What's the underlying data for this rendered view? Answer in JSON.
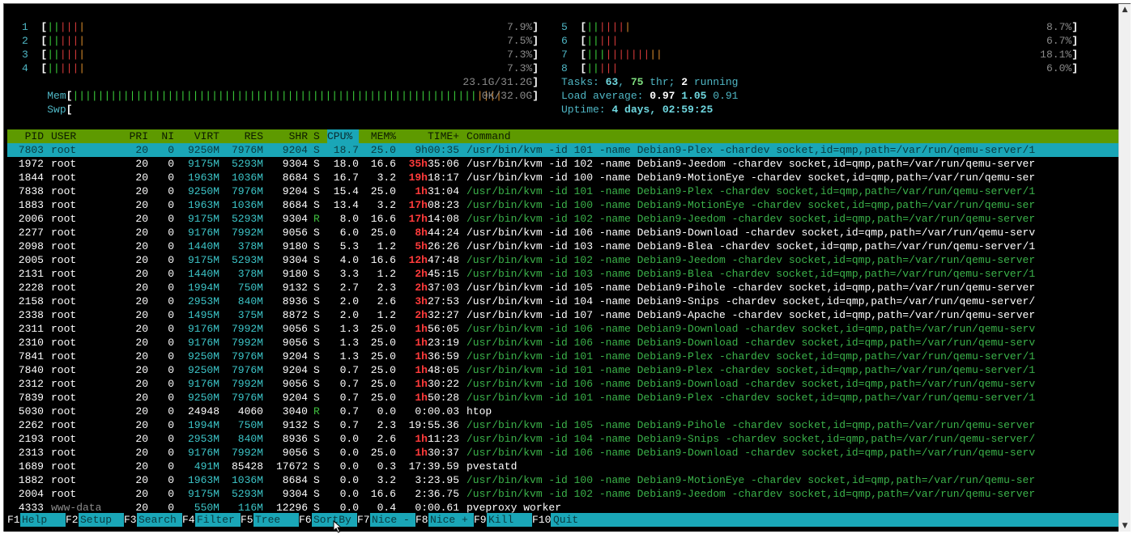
{
  "cpus": [
    {
      "id": "1",
      "bars": [
        {
          "c": "g",
          "t": "||"
        },
        {
          "c": "r",
          "t": "|||"
        },
        {
          "c": "o",
          "t": "|"
        }
      ],
      "pct": "7.9%"
    },
    {
      "id": "2",
      "bars": [
        {
          "c": "g",
          "t": "||"
        },
        {
          "c": "r",
          "t": "|||"
        },
        {
          "c": "o",
          "t": "|"
        }
      ],
      "pct": "7.5%"
    },
    {
      "id": "3",
      "bars": [
        {
          "c": "g",
          "t": "||"
        },
        {
          "c": "r",
          "t": "|||"
        },
        {
          "c": "o",
          "t": "|"
        }
      ],
      "pct": "7.3%"
    },
    {
      "id": "4",
      "bars": [
        {
          "c": "g",
          "t": "||"
        },
        {
          "c": "r",
          "t": "|||"
        },
        {
          "c": "o",
          "t": "|"
        }
      ],
      "pct": "7.3%"
    },
    {
      "id": "5",
      "bars": [
        {
          "c": "g",
          "t": "||"
        },
        {
          "c": "r",
          "t": "||||"
        },
        {
          "c": "o",
          "t": "|"
        }
      ],
      "pct": "8.7%"
    },
    {
      "id": "6",
      "bars": [
        {
          "c": "g",
          "t": "||"
        },
        {
          "c": "r",
          "t": "|||"
        }
      ],
      "pct": "6.7%"
    },
    {
      "id": "7",
      "bars": [
        {
          "c": "g",
          "t": "|||"
        },
        {
          "c": "r",
          "t": "|||||||"
        },
        {
          "c": "o",
          "t": "||"
        }
      ],
      "pct": "18.1%"
    },
    {
      "id": "8",
      "bars": [
        {
          "c": "g",
          "t": "||"
        },
        {
          "c": "r",
          "t": "|||"
        }
      ],
      "pct": "6.0%"
    }
  ],
  "mem": {
    "label": "Mem",
    "bars": "||||||||||||||||||||||||||||||||||||||||||||||||||||||||||||||||",
    "tail": "||||",
    "value": "23.1G/31.2G"
  },
  "swp": {
    "label": "Swp",
    "value": "0K/32.0G"
  },
  "tasks": {
    "label": "Tasks: ",
    "count": "63",
    "sep": ", ",
    "threads": "75",
    "thr": " thr; ",
    "running": "2",
    "running_label": " running"
  },
  "load": {
    "label": "Load average: ",
    "l1": "0.97",
    "l5": "1.05",
    "l15": "0.91"
  },
  "uptime": {
    "label": "Uptime: ",
    "value": "4 days, 02:59:25"
  },
  "columns": [
    "PID",
    "USER",
    "PRI",
    "NI",
    "VIRT",
    "RES",
    "SHR",
    "S",
    "CPU%",
    "MEM%",
    "TIME+",
    "Command"
  ],
  "processes": [
    {
      "pid": "7803",
      "user": "root",
      "pri": "20",
      "ni": "0",
      "virt": "9250M",
      "res": "7976M",
      "shr": "9204",
      "s": "S",
      "cpu": "18.7",
      "mem": "25.0",
      "timeh": "9h",
      "timem": "00:35",
      "cmd": "/usr/bin/kvm -id 101 -name Debian9-Plex -chardev socket,id=qmp,path=/var/run/qemu-server/1",
      "thread": false,
      "sel": true
    },
    {
      "pid": "1972",
      "user": "root",
      "pri": "20",
      "ni": "0",
      "virt": "9175M",
      "res": "5293M",
      "shr": "9304",
      "s": "S",
      "cpu": "18.0",
      "mem": "16.6",
      "timeh": "35h",
      "timem": "35:06",
      "cmd": "/usr/bin/kvm -id 102 -name Debian9-Jeedom -chardev socket,id=qmp,path=/var/run/qemu-server",
      "thread": false
    },
    {
      "pid": "1844",
      "user": "root",
      "pri": "20",
      "ni": "0",
      "virt": "1963M",
      "res": "1036M",
      "shr": "8684",
      "s": "S",
      "cpu": "16.7",
      "mem": "3.2",
      "timeh": "19h",
      "timem": "18:17",
      "cmd": "/usr/bin/kvm -id 100 -name Debian9-MotionEye -chardev socket,id=qmp,path=/var/run/qemu-ser",
      "thread": false
    },
    {
      "pid": "7838",
      "user": "root",
      "pri": "20",
      "ni": "0",
      "virt": "9250M",
      "res": "7976M",
      "shr": "9204",
      "s": "S",
      "cpu": "15.4",
      "mem": "25.0",
      "timeh": "1h",
      "timem": "31:04",
      "cmd": "/usr/bin/kvm -id 101 -name Debian9-Plex -chardev socket,id=qmp,path=/var/run/qemu-server/1",
      "thread": true
    },
    {
      "pid": "1883",
      "user": "root",
      "pri": "20",
      "ni": "0",
      "virt": "1963M",
      "res": "1036M",
      "shr": "8684",
      "s": "S",
      "cpu": "13.4",
      "mem": "3.2",
      "timeh": "17h",
      "timem": "08:23",
      "cmd": "/usr/bin/kvm -id 100 -name Debian9-MotionEye -chardev socket,id=qmp,path=/var/run/qemu-ser",
      "thread": true
    },
    {
      "pid": "2006",
      "user": "root",
      "pri": "20",
      "ni": "0",
      "virt": "9175M",
      "res": "5293M",
      "shr": "9304",
      "s": "R",
      "cpu": "8.0",
      "mem": "16.6",
      "timeh": "17h",
      "timem": "14:08",
      "cmd": "/usr/bin/kvm -id 102 -name Debian9-Jeedom -chardev socket,id=qmp,path=/var/run/qemu-server",
      "thread": true
    },
    {
      "pid": "2277",
      "user": "root",
      "pri": "20",
      "ni": "0",
      "virt": "9176M",
      "res": "7992M",
      "shr": "9056",
      "s": "S",
      "cpu": "6.0",
      "mem": "25.0",
      "timeh": "8h",
      "timem": "44:24",
      "cmd": "/usr/bin/kvm -id 106 -name Debian9-Download -chardev socket,id=qmp,path=/var/run/qemu-serv",
      "thread": false
    },
    {
      "pid": "2098",
      "user": "root",
      "pri": "20",
      "ni": "0",
      "virt": "1440M",
      "res": "378M",
      "shr": "9180",
      "s": "S",
      "cpu": "5.3",
      "mem": "1.2",
      "timeh": "5h",
      "timem": "26:26",
      "cmd": "/usr/bin/kvm -id 103 -name Debian9-Blea -chardev socket,id=qmp,path=/var/run/qemu-server/1",
      "thread": false
    },
    {
      "pid": "2005",
      "user": "root",
      "pri": "20",
      "ni": "0",
      "virt": "9175M",
      "res": "5293M",
      "shr": "9304",
      "s": "S",
      "cpu": "4.0",
      "mem": "16.6",
      "timeh": "12h",
      "timem": "47:48",
      "cmd": "/usr/bin/kvm -id 102 -name Debian9-Jeedom -chardev socket,id=qmp,path=/var/run/qemu-server",
      "thread": true
    },
    {
      "pid": "2131",
      "user": "root",
      "pri": "20",
      "ni": "0",
      "virt": "1440M",
      "res": "378M",
      "shr": "9180",
      "s": "S",
      "cpu": "3.3",
      "mem": "1.2",
      "timeh": "2h",
      "timem": "45:15",
      "cmd": "/usr/bin/kvm -id 103 -name Debian9-Blea -chardev socket,id=qmp,path=/var/run/qemu-server/1",
      "thread": true
    },
    {
      "pid": "2228",
      "user": "root",
      "pri": "20",
      "ni": "0",
      "virt": "1994M",
      "res": "750M",
      "shr": "9132",
      "s": "S",
      "cpu": "2.7",
      "mem": "2.3",
      "timeh": "2h",
      "timem": "37:03",
      "cmd": "/usr/bin/kvm -id 105 -name Debian9-Pihole -chardev socket,id=qmp,path=/var/run/qemu-server",
      "thread": false
    },
    {
      "pid": "2158",
      "user": "root",
      "pri": "20",
      "ni": "0",
      "virt": "2953M",
      "res": "840M",
      "shr": "8936",
      "s": "S",
      "cpu": "2.0",
      "mem": "2.6",
      "timeh": "3h",
      "timem": "27:53",
      "cmd": "/usr/bin/kvm -id 104 -name Debian9-Snips -chardev socket,id=qmp,path=/var/run/qemu-server/",
      "thread": false
    },
    {
      "pid": "2338",
      "user": "root",
      "pri": "20",
      "ni": "0",
      "virt": "1495M",
      "res": "375M",
      "shr": "8872",
      "s": "S",
      "cpu": "2.0",
      "mem": "1.2",
      "timeh": "2h",
      "timem": "32:27",
      "cmd": "/usr/bin/kvm -id 107 -name Debian9-Apache -chardev socket,id=qmp,path=/var/run/qemu-server",
      "thread": false
    },
    {
      "pid": "2311",
      "user": "root",
      "pri": "20",
      "ni": "0",
      "virt": "9176M",
      "res": "7992M",
      "shr": "9056",
      "s": "S",
      "cpu": "1.3",
      "mem": "25.0",
      "timeh": "1h",
      "timem": "56:05",
      "cmd": "/usr/bin/kvm -id 106 -name Debian9-Download -chardev socket,id=qmp,path=/var/run/qemu-serv",
      "thread": true
    },
    {
      "pid": "2310",
      "user": "root",
      "pri": "20",
      "ni": "0",
      "virt": "9176M",
      "res": "7992M",
      "shr": "9056",
      "s": "S",
      "cpu": "1.3",
      "mem": "25.0",
      "timeh": "1h",
      "timem": "23:19",
      "cmd": "/usr/bin/kvm -id 106 -name Debian9-Download -chardev socket,id=qmp,path=/var/run/qemu-serv",
      "thread": true
    },
    {
      "pid": "7841",
      "user": "root",
      "pri": "20",
      "ni": "0",
      "virt": "9250M",
      "res": "7976M",
      "shr": "9204",
      "s": "S",
      "cpu": "1.3",
      "mem": "25.0",
      "timeh": "1h",
      "timem": "36:59",
      "cmd": "/usr/bin/kvm -id 101 -name Debian9-Plex -chardev socket,id=qmp,path=/var/run/qemu-server/1",
      "thread": true
    },
    {
      "pid": "7840",
      "user": "root",
      "pri": "20",
      "ni": "0",
      "virt": "9250M",
      "res": "7976M",
      "shr": "9204",
      "s": "S",
      "cpu": "0.7",
      "mem": "25.0",
      "timeh": "1h",
      "timem": "48:05",
      "cmd": "/usr/bin/kvm -id 101 -name Debian9-Plex -chardev socket,id=qmp,path=/var/run/qemu-server/1",
      "thread": true
    },
    {
      "pid": "2312",
      "user": "root",
      "pri": "20",
      "ni": "0",
      "virt": "9176M",
      "res": "7992M",
      "shr": "9056",
      "s": "S",
      "cpu": "0.7",
      "mem": "25.0",
      "timeh": "1h",
      "timem": "30:22",
      "cmd": "/usr/bin/kvm -id 106 -name Debian9-Download -chardev socket,id=qmp,path=/var/run/qemu-serv",
      "thread": true
    },
    {
      "pid": "7839",
      "user": "root",
      "pri": "20",
      "ni": "0",
      "virt": "9250M",
      "res": "7976M",
      "shr": "9204",
      "s": "S",
      "cpu": "0.7",
      "mem": "25.0",
      "timeh": "1h",
      "timem": "50:28",
      "cmd": "/usr/bin/kvm -id 101 -name Debian9-Plex -chardev socket,id=qmp,path=/var/run/qemu-server/1",
      "thread": true
    },
    {
      "pid": "5030",
      "user": "root",
      "pri": "20",
      "ni": "0",
      "virt": "24948",
      "res": "4060",
      "shr": "3040",
      "s": "R",
      "cpu": "0.7",
      "mem": "0.0",
      "timeh": "",
      "timem": "0:00.03",
      "cmd": "htop",
      "thread": false
    },
    {
      "pid": "2262",
      "user": "root",
      "pri": "20",
      "ni": "0",
      "virt": "1994M",
      "res": "750M",
      "shr": "9132",
      "s": "S",
      "cpu": "0.7",
      "mem": "2.3",
      "timeh": "",
      "timem": "19:55.36",
      "cmd": "/usr/bin/kvm -id 105 -name Debian9-Pihole -chardev socket,id=qmp,path=/var/run/qemu-server",
      "thread": true
    },
    {
      "pid": "2193",
      "user": "root",
      "pri": "20",
      "ni": "0",
      "virt": "2953M",
      "res": "840M",
      "shr": "8936",
      "s": "S",
      "cpu": "0.0",
      "mem": "2.6",
      "timeh": "1h",
      "timem": "11:23",
      "cmd": "/usr/bin/kvm -id 104 -name Debian9-Snips -chardev socket,id=qmp,path=/var/run/qemu-server/",
      "thread": true
    },
    {
      "pid": "2313",
      "user": "root",
      "pri": "20",
      "ni": "0",
      "virt": "9176M",
      "res": "7992M",
      "shr": "9056",
      "s": "S",
      "cpu": "0.0",
      "mem": "25.0",
      "timeh": "1h",
      "timem": "30:37",
      "cmd": "/usr/bin/kvm -id 106 -name Debian9-Download -chardev socket,id=qmp,path=/var/run/qemu-serv",
      "thread": true
    },
    {
      "pid": "1689",
      "user": "root",
      "pri": "20",
      "ni": "0",
      "virt": "491M",
      "res": "85428",
      "shr": "17672",
      "s": "S",
      "cpu": "0.0",
      "mem": "0.3",
      "timeh": "",
      "timem": "17:39.59",
      "cmd": "pvestatd",
      "thread": false
    },
    {
      "pid": "1882",
      "user": "root",
      "pri": "20",
      "ni": "0",
      "virt": "1963M",
      "res": "1036M",
      "shr": "8684",
      "s": "S",
      "cpu": "0.0",
      "mem": "3.2",
      "timeh": "",
      "timem": "3:23.95",
      "cmd": "/usr/bin/kvm -id 100 -name Debian9-MotionEye -chardev socket,id=qmp,path=/var/run/qemu-ser",
      "thread": true
    },
    {
      "pid": "2004",
      "user": "root",
      "pri": "20",
      "ni": "0",
      "virt": "9175M",
      "res": "5293M",
      "shr": "9304",
      "s": "S",
      "cpu": "0.0",
      "mem": "16.6",
      "timeh": "",
      "timem": "2:36.75",
      "cmd": "/usr/bin/kvm -id 102 -name Debian9-Jeedom -chardev socket,id=qmp,path=/var/run/qemu-server",
      "thread": true
    },
    {
      "pid": "4333",
      "user": "www-data",
      "pri": "20",
      "ni": "0",
      "virt": "550M",
      "res": "116M",
      "shr": "12296",
      "s": "S",
      "cpu": "0.0",
      "mem": "0.4",
      "timeh": "",
      "timem": "0:00.61",
      "cmd": "pveproxy worker",
      "thread": false
    }
  ],
  "fkeys": [
    {
      "key": "F1",
      "label": "Help"
    },
    {
      "key": "F2",
      "label": "Setup"
    },
    {
      "key": "F3",
      "label": "Search"
    },
    {
      "key": "F4",
      "label": "Filter"
    },
    {
      "key": "F5",
      "label": "Tree"
    },
    {
      "key": "F6",
      "label": "SortBy"
    },
    {
      "key": "F7",
      "label": "Nice -"
    },
    {
      "key": "F8",
      "label": "Nice +"
    },
    {
      "key": "F9",
      "label": "Kill"
    },
    {
      "key": "F10",
      "label": "Quit"
    }
  ],
  "colors": {
    "header_bg": "#5e9a00",
    "selection_bg": "#1aa6b7",
    "thread_green": "#3bb24a",
    "time_red": "#ff3b3b"
  },
  "icons": {
    "scroll_up": "scroll-up-arrow-icon",
    "scroll_down": "scroll-down-arrow-icon",
    "cursor": "mouse-pointer-icon"
  }
}
